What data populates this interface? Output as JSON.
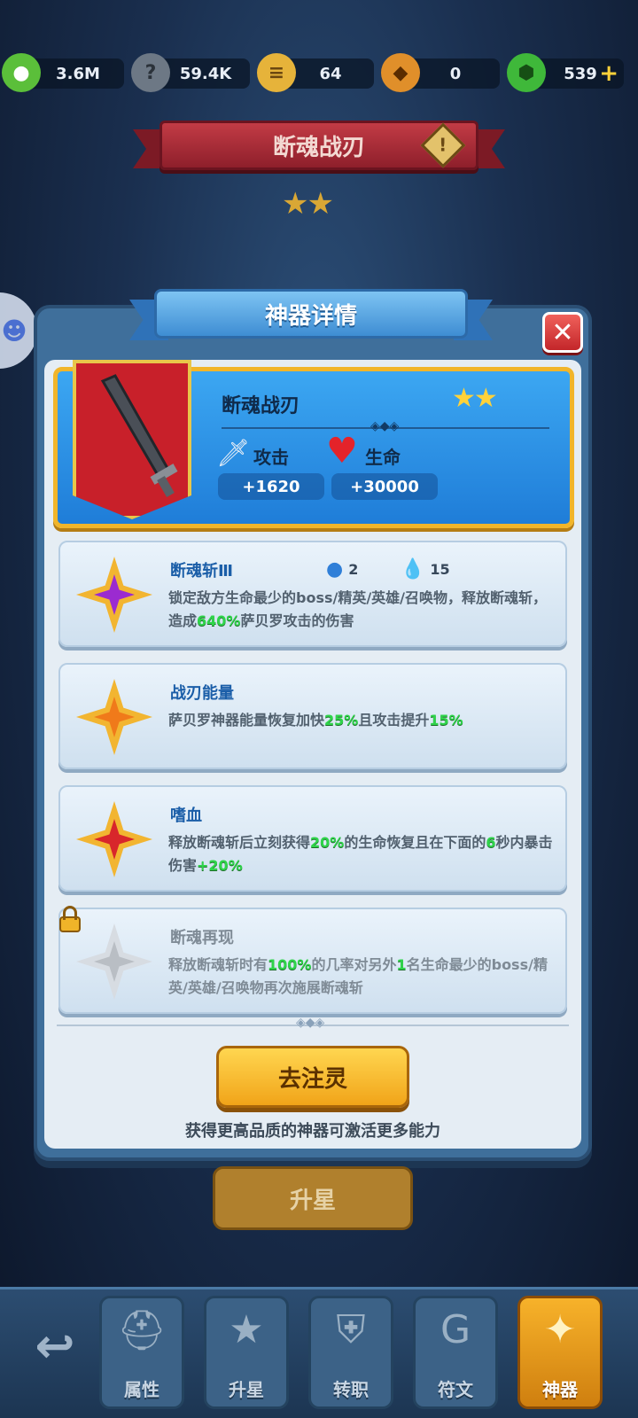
{
  "resources": [
    {
      "icon": "green-blob-icon",
      "value": "3.6M",
      "color": "#5bbf3a"
    },
    {
      "icon": "stone-icon",
      "value": "59.4K",
      "color": "#6d7885"
    },
    {
      "icon": "scroll-icon",
      "value": "64",
      "color": "#e6b33a"
    },
    {
      "icon": "egg-icon",
      "value": "0",
      "color": "#e08f2a"
    },
    {
      "icon": "green-gem-icon",
      "value": "539",
      "color": "#3fb83a",
      "plus": "+"
    }
  ],
  "page_title": "断魂战刃",
  "page_stars": "★★",
  "modal": {
    "title": "神器详情",
    "close": "✕",
    "artifact": {
      "name": "断魂战刃",
      "stars": "★★",
      "attack_label": "攻击",
      "attack_value": "+1620",
      "life_label": "生命",
      "life_value": "+30000"
    },
    "skills": [
      {
        "name": "断魂斩Ⅲ",
        "costs": [
          {
            "icon": "bomb-potion-icon",
            "value": "2"
          },
          {
            "icon": "water-drops-icon",
            "value": "15"
          }
        ],
        "desc_parts": [
          "锁定敌方生命最少的boss/精英/英雄/召唤物，释放断魂斩，造成",
          "640%",
          "萨贝罗攻击的伤害"
        ],
        "gem_color": "#9b2bd0",
        "locked": false
      },
      {
        "name": "战刃能量",
        "desc_parts": [
          "萨贝罗神器能量恢复加快",
          "25%",
          "且攻击提升",
          "15%"
        ],
        "gem_color": "#f07a1a",
        "locked": false
      },
      {
        "name": "嗜血",
        "desc_parts": [
          "释放断魂斩后立刻获得",
          "20%",
          "的生命恢复且在下面的",
          "6",
          "秒内暴击伤害",
          "+20%"
        ],
        "gem_color": "#d8262b",
        "locked": false
      },
      {
        "name": "断魂再现",
        "desc_parts": [
          "释放断魂斩时有",
          "100%",
          "的几率对另外",
          "1",
          "名生命最少的boss/精英/英雄/召唤物再次施展断魂斩"
        ],
        "gem_color": "#b9bec4",
        "locked": true
      }
    ],
    "go_button": "去注灵",
    "hint": "获得更高品质的神器可激活更多能力"
  },
  "star_up_button": "升星",
  "bottom_nav": {
    "back_icon": "↩",
    "tabs": [
      {
        "label": "属性",
        "icon": "helmet-icon",
        "glyph": "⛑",
        "active": false
      },
      {
        "label": "升星",
        "icon": "star-icon",
        "glyph": "★",
        "active": false
      },
      {
        "label": "转职",
        "icon": "shield-icon",
        "glyph": "⛨",
        "active": false
      },
      {
        "label": "符文",
        "icon": "rune-icon",
        "glyph": "G",
        "active": false
      },
      {
        "label": "神器",
        "icon": "artifact-emblem-icon",
        "glyph": "✦",
        "active": true
      }
    ]
  }
}
